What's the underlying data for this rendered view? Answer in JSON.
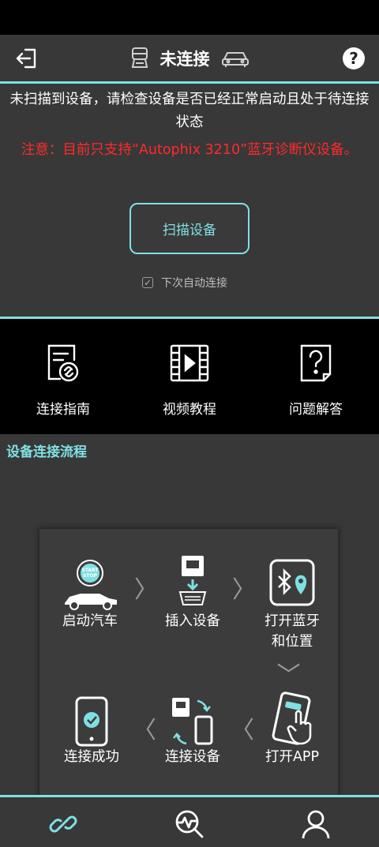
{
  "header": {
    "back_icon": "logout-icon",
    "title": "未连接",
    "help_label": "?"
  },
  "scan": {
    "message": "未扫描到设备，请检查设备是否已经正常启动且处于待连接状态",
    "warning": "注意：目前只支持“Autophix 3210”蓝牙诊断仪设备。",
    "button_label": "扫描设备",
    "auto_connect_label": "下次自动连接",
    "auto_connect_checked": true
  },
  "shortcuts": [
    {
      "label": "连接指南",
      "icon": "guide-link-icon"
    },
    {
      "label": "视频教程",
      "icon": "video-icon"
    },
    {
      "label": "问题解答",
      "icon": "faq-icon"
    }
  ],
  "flow": {
    "title": "设备连接流程",
    "steps": [
      {
        "label": "启动汽车",
        "icon": "start-car-icon"
      },
      {
        "label": "插入设备",
        "icon": "plug-device-icon"
      },
      {
        "label": "打开蓝牙和位置",
        "icon": "bluetooth-location-icon"
      },
      {
        "label": "打开APP",
        "icon": "open-app-icon"
      },
      {
        "label": "连接设备",
        "icon": "connect-device-icon"
      },
      {
        "label": "连接成功",
        "icon": "success-phone-icon"
      }
    ],
    "start_stop_text": "START STOP"
  },
  "nav": [
    {
      "name": "connect",
      "icon": "link-icon",
      "active": true
    },
    {
      "name": "diagnose",
      "icon": "diagnose-search-icon",
      "active": false
    },
    {
      "name": "profile",
      "icon": "user-icon",
      "active": false
    }
  ],
  "colors": {
    "accent": "#7fe0e3",
    "warning": "#ff2a2a",
    "panel": "#383838",
    "background": "#000000"
  }
}
